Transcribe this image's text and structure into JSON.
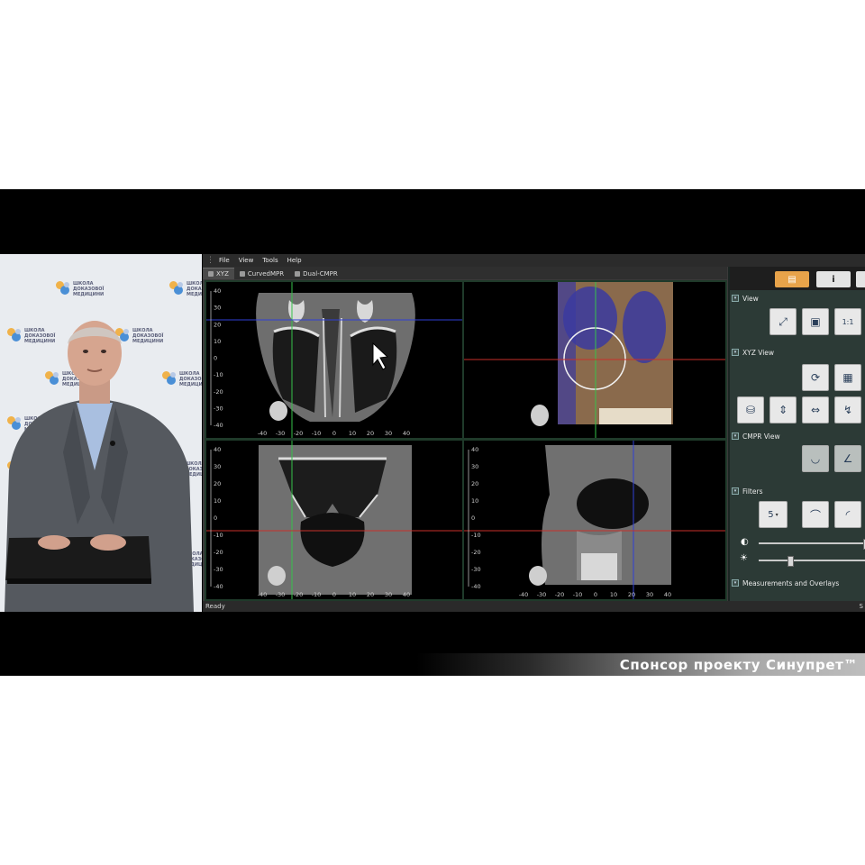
{
  "menu": {
    "file": "File",
    "view": "View",
    "tools": "Tools",
    "help": "Help"
  },
  "tabs": [
    {
      "label": "XYZ",
      "active": true
    },
    {
      "label": "CurvedMPR",
      "active": false
    },
    {
      "label": "Dual-CMPR",
      "active": false
    }
  ],
  "axes": {
    "vertical_ticks": [
      "40",
      "30",
      "20",
      "10",
      "0",
      "-10",
      "-20",
      "-30",
      "-40"
    ],
    "horizontal_ticks": [
      "-40",
      "-30",
      "-20",
      "-10",
      "0",
      "10",
      "20",
      "30",
      "40"
    ]
  },
  "panel": {
    "sections": {
      "view": "View",
      "xyz_view": "XYZ View",
      "cmpr_view": "CMPR View",
      "filters": "Filters",
      "measurements": "Measurements and Overlays"
    },
    "ratio_button": "1:1",
    "info_icon": "i",
    "filter_value": "5",
    "contrast_icon": "◐",
    "brightness_icon": "☀"
  },
  "status": {
    "text": "Ready",
    "right": "S"
  },
  "logos": {
    "line1": "ШКОЛА",
    "line2": "ДОКАЗОВОЇ",
    "line3": "МЕДИЦИНИ"
  },
  "banner": {
    "text": "Спонсор проекту Синупрет™"
  },
  "colors": {
    "crosshair_green": "#36c24a",
    "crosshair_red": "#c8302a",
    "crosshair_blue": "#2f3fd6",
    "accent_orange": "#e8a34a"
  }
}
